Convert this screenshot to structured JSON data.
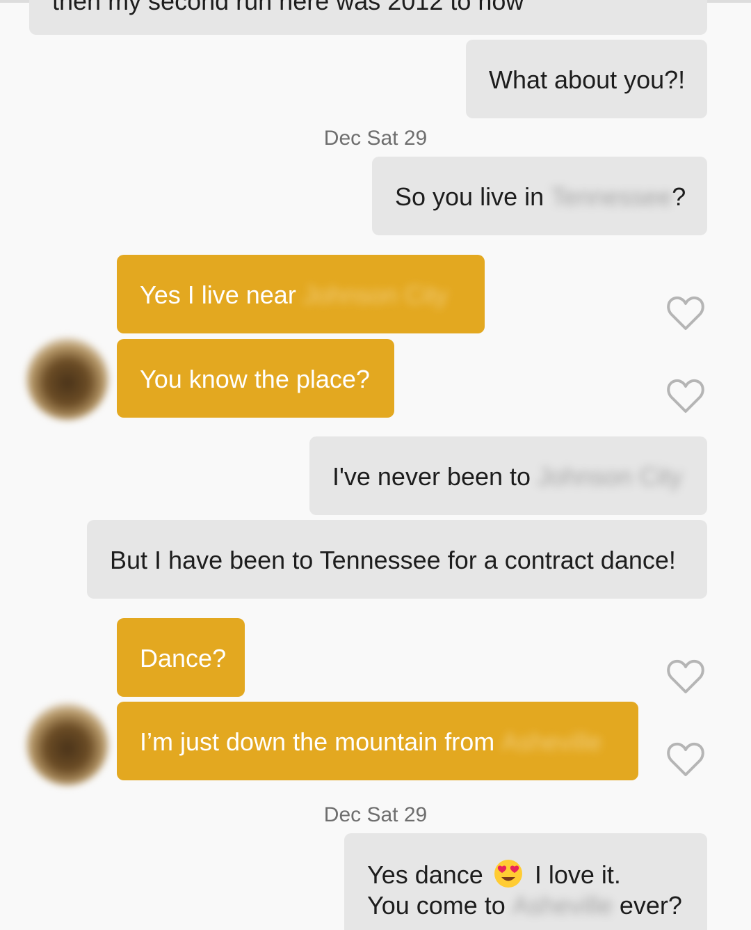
{
  "messages": [
    {
      "id": "m0",
      "dir": "out",
      "text": "then my second run here was 2012 to now"
    },
    {
      "id": "m1",
      "dir": "out",
      "text": "What about you?!"
    },
    {
      "id": "m2",
      "dir": "out",
      "text_before": "So you live in ",
      "redacted": "Tennessee",
      "text_after": "?"
    },
    {
      "id": "m3",
      "dir": "in",
      "text_before": "Yes I live near ",
      "redacted": "Johnson City"
    },
    {
      "id": "m4",
      "dir": "in",
      "text": "You know the place?"
    },
    {
      "id": "m5",
      "dir": "out",
      "text_before": "I've never been to ",
      "redacted": "Johnson City"
    },
    {
      "id": "m6",
      "dir": "out",
      "text": "But I have been to Tennessee for a contract dance!"
    },
    {
      "id": "m7",
      "dir": "in",
      "text": "Dance?"
    },
    {
      "id": "m8",
      "dir": "in",
      "text_before": "I’m just down the mountain from ",
      "redacted": "Asheville"
    },
    {
      "id": "m9",
      "dir": "out",
      "line1_before": "Yes dance ",
      "emoji": "smiling-face-with-heart-eyes",
      "line1_after": " I love it.",
      "line2_before": "You come to ",
      "redacted": "Asheville",
      "line2_after": " ever?"
    }
  ],
  "timestamps": [
    "Dec Sat 29",
    "Dec Sat 29"
  ],
  "colors": {
    "background": "#f9f9f9",
    "outgoing_bubble": "#e6e6e6",
    "incoming_bubble": "#e3a820",
    "timestamp_text": "#6e6e6e",
    "heart_outline": "#b5b5b5"
  },
  "icons": [
    "heart-outline-icon",
    "avatar"
  ]
}
